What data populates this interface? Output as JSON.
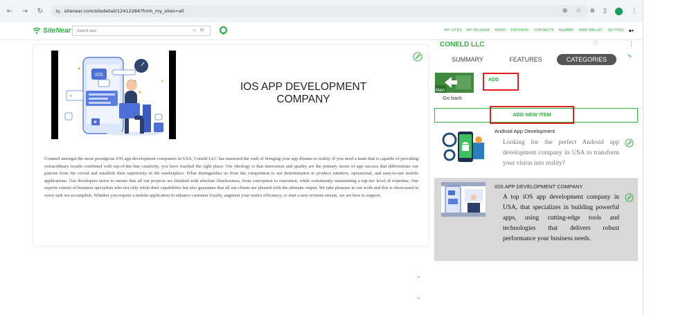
{
  "browser": {
    "url": "sitenear.com/sitedetail/12412284?from_my_sites=all",
    "back_icon": "arrow-left",
    "forward_icon": "arrow-right",
    "reload_icon": "reload",
    "site_info_icon": "tune"
  },
  "header": {
    "logo_text": "SiteNear",
    "logo_sup": "™",
    "search_placeholder": "Search sites",
    "nav": [
      "MY SITES",
      "MY RELEASE",
      "NEWS",
      "FAVORITE",
      "CONTACTS",
      "NEARBY",
      "WEB WALLET",
      "SETTING"
    ],
    "brand_color": "#2db13c"
  },
  "main": {
    "title": "IOS APP DEVELOPMENT COMPANY",
    "description": "Counted amongst the most prestigious iOS app development companies in USA, Coneld LLC has mastered the craft of bringing your app dreams to reality. If you need a team that is capable of providing extraordinary results combined with top-of-the-line creativity, you have reached the right place. Our ideology is that innovation and quality are the primary facets of app success that differentiate our patrons from the crowd and establish their superiority in the marketplace. What distinguishes us from the competition is our determination to produce intuitive, operational, and easy-to-use mobile applications. Our developers strive to ensure that all our projects are finished with absolute flawlessness, from conception to execution, while consistently maintaining a top-tier level of expertise. Our experts consist of business specialists who not only relish their capabilities but also guarantee that all our clients are pleased with the ultimate output. We take pleasure in our work and this is showcased in every task we accomplish. Whether you require a mobile application to enhance customer loyalty, augment your team's efficiency, or start a new revenue stream, we are here to support.",
    "hero_label": "iOS"
  },
  "right": {
    "company": "CONELD LLC",
    "tabs": [
      "SUMMARY",
      "FEATURES",
      "CATEGORIES"
    ],
    "active_tab": "CATEGORIES",
    "goback_label": "Go back",
    "goback_img_text": "Main",
    "add_label": "ADD",
    "add_new_label": "ADD NEW ITEM",
    "items": [
      {
        "title": "Android App Development",
        "desc": "Looking for the perfect Android app development company in USA to transform your vision into reality?"
      },
      {
        "title": "IOS APP DEVELOPMENT COMPANY",
        "desc": "A top iOS app development company in USA, that specializes in building powerful apps, using cutting-edge tools and technologies that delivers robust performance your business needs."
      }
    ]
  }
}
